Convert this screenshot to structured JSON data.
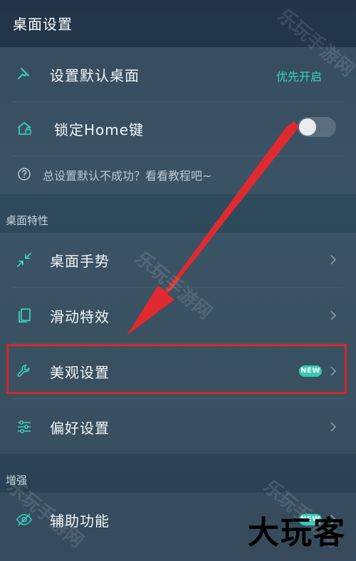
{
  "header": {
    "title": "桌面设置"
  },
  "group1": {
    "default_launcher": {
      "label": "设置默认桌面",
      "action": "优先开启",
      "icon": "pin-icon"
    },
    "lock_home": {
      "label": "锁定Home键",
      "toggle_on": false,
      "icon": "home-lock-icon"
    },
    "hint": {
      "text": "总设置默认不成功？看看教程吧~",
      "icon": "question-circle-icon"
    }
  },
  "sections": {
    "desktop_features": "桌面特性",
    "enhance": "增强"
  },
  "group2": {
    "gestures": {
      "label": "桌面手势",
      "icon": "gesture-compress-icon"
    },
    "scroll_effects": {
      "label": "滑动特效",
      "icon": "copy-cards-icon"
    },
    "appearance": {
      "label": "美观设置",
      "badge": "NEW",
      "icon": "wrench-icon"
    },
    "preferences": {
      "label": "偏好设置",
      "icon": "sliders-icon"
    }
  },
  "group3": {
    "accessibility": {
      "label": "辅助功能",
      "badge": "NEW",
      "icon": "eye-slash-icon"
    }
  },
  "watermarks": {
    "text": "乐玩手游网"
  },
  "overlay": {
    "text": "大玩客"
  },
  "colors": {
    "accent": "#33d6c8",
    "badge": "#35c9b2",
    "highlight": "#d6262a",
    "arrow": "#e12a2f"
  }
}
